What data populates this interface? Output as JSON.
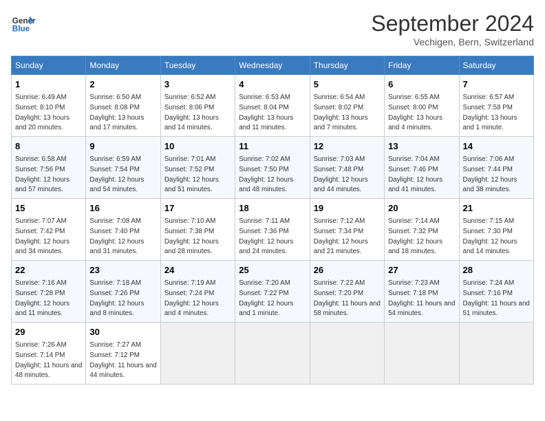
{
  "logo": {
    "line1": "General",
    "line2": "Blue"
  },
  "title": "September 2024",
  "subtitle": "Vechigen, Bern, Switzerland",
  "days_of_week": [
    "Sunday",
    "Monday",
    "Tuesday",
    "Wednesday",
    "Thursday",
    "Friday",
    "Saturday"
  ],
  "weeks": [
    [
      {
        "day": "1",
        "sunrise": "6:49 AM",
        "sunset": "8:10 PM",
        "daylight": "13 hours and 20 minutes."
      },
      {
        "day": "2",
        "sunrise": "6:50 AM",
        "sunset": "8:08 PM",
        "daylight": "13 hours and 17 minutes."
      },
      {
        "day": "3",
        "sunrise": "6:52 AM",
        "sunset": "8:06 PM",
        "daylight": "13 hours and 14 minutes."
      },
      {
        "day": "4",
        "sunrise": "6:53 AM",
        "sunset": "8:04 PM",
        "daylight": "13 hours and 11 minutes."
      },
      {
        "day": "5",
        "sunrise": "6:54 AM",
        "sunset": "8:02 PM",
        "daylight": "13 hours and 7 minutes."
      },
      {
        "day": "6",
        "sunrise": "6:55 AM",
        "sunset": "8:00 PM",
        "daylight": "13 hours and 4 minutes."
      },
      {
        "day": "7",
        "sunrise": "6:57 AM",
        "sunset": "7:58 PM",
        "daylight": "13 hours and 1 minute."
      }
    ],
    [
      {
        "day": "8",
        "sunrise": "6:58 AM",
        "sunset": "7:56 PM",
        "daylight": "12 hours and 57 minutes."
      },
      {
        "day": "9",
        "sunrise": "6:59 AM",
        "sunset": "7:54 PM",
        "daylight": "12 hours and 54 minutes."
      },
      {
        "day": "10",
        "sunrise": "7:01 AM",
        "sunset": "7:52 PM",
        "daylight": "12 hours and 51 minutes."
      },
      {
        "day": "11",
        "sunrise": "7:02 AM",
        "sunset": "7:50 PM",
        "daylight": "12 hours and 48 minutes."
      },
      {
        "day": "12",
        "sunrise": "7:03 AM",
        "sunset": "7:48 PM",
        "daylight": "12 hours and 44 minutes."
      },
      {
        "day": "13",
        "sunrise": "7:04 AM",
        "sunset": "7:46 PM",
        "daylight": "12 hours and 41 minutes."
      },
      {
        "day": "14",
        "sunrise": "7:06 AM",
        "sunset": "7:44 PM",
        "daylight": "12 hours and 38 minutes."
      }
    ],
    [
      {
        "day": "15",
        "sunrise": "7:07 AM",
        "sunset": "7:42 PM",
        "daylight": "12 hours and 34 minutes."
      },
      {
        "day": "16",
        "sunrise": "7:08 AM",
        "sunset": "7:40 PM",
        "daylight": "12 hours and 31 minutes."
      },
      {
        "day": "17",
        "sunrise": "7:10 AM",
        "sunset": "7:38 PM",
        "daylight": "12 hours and 28 minutes."
      },
      {
        "day": "18",
        "sunrise": "7:11 AM",
        "sunset": "7:36 PM",
        "daylight": "12 hours and 24 minutes."
      },
      {
        "day": "19",
        "sunrise": "7:12 AM",
        "sunset": "7:34 PM",
        "daylight": "12 hours and 21 minutes."
      },
      {
        "day": "20",
        "sunrise": "7:14 AM",
        "sunset": "7:32 PM",
        "daylight": "12 hours and 18 minutes."
      },
      {
        "day": "21",
        "sunrise": "7:15 AM",
        "sunset": "7:30 PM",
        "daylight": "12 hours and 14 minutes."
      }
    ],
    [
      {
        "day": "22",
        "sunrise": "7:16 AM",
        "sunset": "7:28 PM",
        "daylight": "12 hours and 11 minutes."
      },
      {
        "day": "23",
        "sunrise": "7:18 AM",
        "sunset": "7:26 PM",
        "daylight": "12 hours and 8 minutes."
      },
      {
        "day": "24",
        "sunrise": "7:19 AM",
        "sunset": "7:24 PM",
        "daylight": "12 hours and 4 minutes."
      },
      {
        "day": "25",
        "sunrise": "7:20 AM",
        "sunset": "7:22 PM",
        "daylight": "12 hours and 1 minute."
      },
      {
        "day": "26",
        "sunrise": "7:22 AM",
        "sunset": "7:20 PM",
        "daylight": "11 hours and 58 minutes."
      },
      {
        "day": "27",
        "sunrise": "7:23 AM",
        "sunset": "7:18 PM",
        "daylight": "11 hours and 54 minutes."
      },
      {
        "day": "28",
        "sunrise": "7:24 AM",
        "sunset": "7:16 PM",
        "daylight": "11 hours and 51 minutes."
      }
    ],
    [
      {
        "day": "29",
        "sunrise": "7:26 AM",
        "sunset": "7:14 PM",
        "daylight": "11 hours and 48 minutes."
      },
      {
        "day": "30",
        "sunrise": "7:27 AM",
        "sunset": "7:12 PM",
        "daylight": "11 hours and 44 minutes."
      },
      null,
      null,
      null,
      null,
      null
    ]
  ],
  "labels": {
    "sunrise": "Sunrise:",
    "sunset": "Sunset:",
    "daylight": "Daylight:"
  }
}
